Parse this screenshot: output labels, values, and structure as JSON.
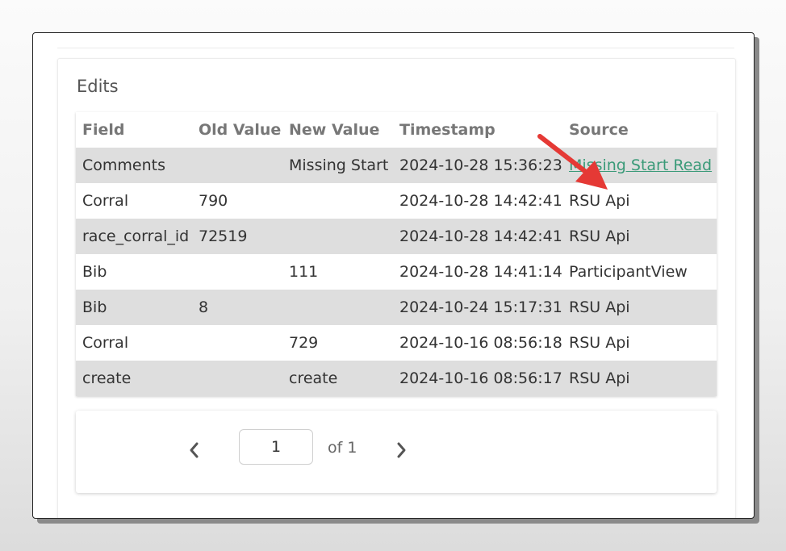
{
  "section_title": "Edits",
  "table": {
    "headers": {
      "field": "Field",
      "old_value": "Old Value",
      "new_value": "New Value",
      "timestamp": "Timestamp",
      "source": "Source"
    },
    "rows": [
      {
        "field": "Comments",
        "old_value": "",
        "new_value": "Missing Start",
        "timestamp": "2024-10-28 15:36:23",
        "source": "Missing Start Read"
      },
      {
        "field": "Corral",
        "old_value": "790",
        "new_value": "",
        "timestamp": "2024-10-28 14:42:41",
        "source": "RSU Api"
      },
      {
        "field": "race_corral_id",
        "old_value": "72519",
        "new_value": "",
        "timestamp": "2024-10-28 14:42:41",
        "source": "RSU Api"
      },
      {
        "field": "Bib",
        "old_value": "",
        "new_value": "111",
        "timestamp": "2024-10-28 14:41:14",
        "source": "ParticipantView"
      },
      {
        "field": "Bib",
        "old_value": "8",
        "new_value": "",
        "timestamp": "2024-10-24 15:17:31",
        "source": "RSU Api"
      },
      {
        "field": "Corral",
        "old_value": "",
        "new_value": "729",
        "timestamp": "2024-10-16 08:56:18",
        "source": "RSU Api"
      },
      {
        "field": "create",
        "old_value": "",
        "new_value": "create",
        "timestamp": "2024-10-16 08:56:17",
        "source": "RSU Api"
      }
    ]
  },
  "pagination": {
    "prev_icon": "chevron-left-icon",
    "next_icon": "chevron-right-icon",
    "current_page": "1",
    "of_label": "of 1"
  },
  "annotation": {
    "icon": "red-arrow-icon",
    "color": "#e53935"
  },
  "colors": {
    "link": "#3a9a78",
    "row_alt": "#dedede"
  }
}
